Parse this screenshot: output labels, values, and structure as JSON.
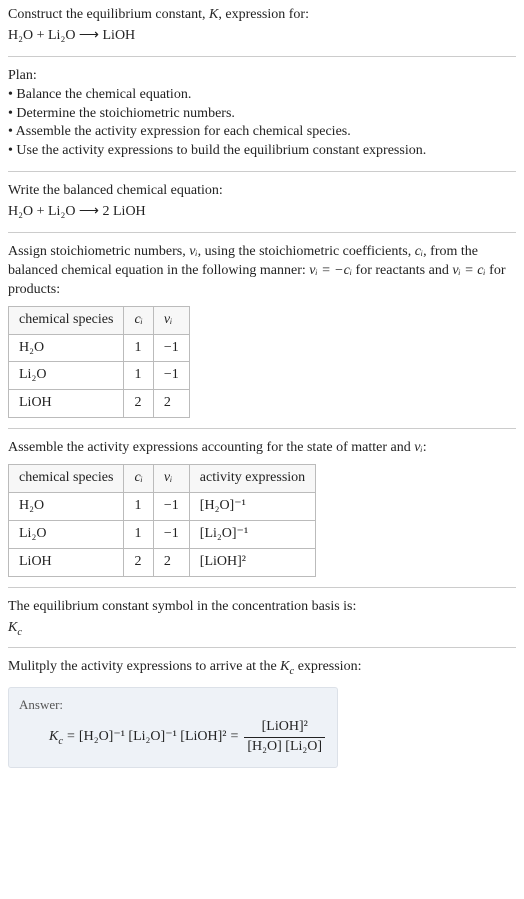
{
  "intro": {
    "line1_pre": "Construct the equilibrium constant, ",
    "line1_k": "K",
    "line1_post": ", expression for:",
    "equation": "H₂O + Li₂O ⟶ LiOH"
  },
  "plan": {
    "heading": "Plan:",
    "b1": "• Balance the chemical equation.",
    "b2": "• Determine the stoichiometric numbers.",
    "b3": "• Assemble the activity expression for each chemical species.",
    "b4": "• Use the activity expressions to build the equilibrium constant expression."
  },
  "balanced": {
    "heading": "Write the balanced chemical equation:",
    "equation": "H₂O + Li₂O ⟶ 2 LiOH"
  },
  "stoich": {
    "text_pre": "Assign stoichiometric numbers, ",
    "nu": "νᵢ",
    "text_mid1": ", using the stoichiometric coefficients, ",
    "ci": "cᵢ",
    "text_mid2": ", from the balanced chemical equation in the following manner: ",
    "rule_react": "νᵢ = −cᵢ",
    "text_mid3": " for reactants and ",
    "rule_prod": "νᵢ = cᵢ",
    "text_end": " for products:",
    "head_species": "chemical species",
    "head_c": "cᵢ",
    "head_nu": "νᵢ",
    "rows": [
      {
        "sp": "H₂O",
        "c": "1",
        "nu": "−1"
      },
      {
        "sp": "Li₂O",
        "c": "1",
        "nu": "−1"
      },
      {
        "sp": "LiOH",
        "c": "2",
        "nu": "2"
      }
    ]
  },
  "activity": {
    "heading_pre": "Assemble the activity expressions accounting for the state of matter and ",
    "heading_nu": "νᵢ",
    "heading_post": ":",
    "head_species": "chemical species",
    "head_c": "cᵢ",
    "head_nu": "νᵢ",
    "head_act": "activity expression",
    "rows": [
      {
        "sp": "H₂O",
        "c": "1",
        "nu": "−1",
        "act": "[H₂O]⁻¹"
      },
      {
        "sp": "Li₂O",
        "c": "1",
        "nu": "−1",
        "act": "[Li₂O]⁻¹"
      },
      {
        "sp": "LiOH",
        "c": "2",
        "nu": "2",
        "act": "[LiOH]²"
      }
    ]
  },
  "symbol": {
    "text": "The equilibrium constant symbol in the concentration basis is:",
    "kc": "K_c"
  },
  "multiply": {
    "text_pre": "Mulitply the activity expressions to arrive at the ",
    "kc": "K_c",
    "text_post": " expression:"
  },
  "answer": {
    "label": "Answer:",
    "lhs": "K_c",
    "eq1": "[H₂O]⁻¹ [Li₂O]⁻¹ [LiOH]²",
    "num": "[LiOH]²",
    "den": "[H₂O] [Li₂O]"
  }
}
